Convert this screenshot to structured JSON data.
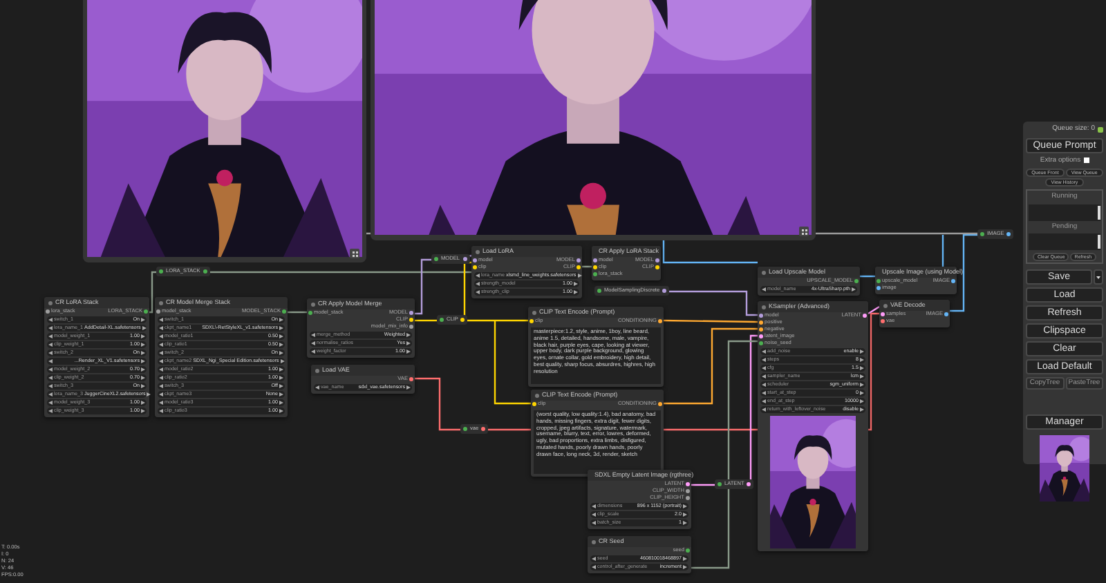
{
  "previews": [
    {
      "kind": "picture"
    },
    {
      "kind": "picture"
    }
  ],
  "nodes": [
    {
      "title": "CR LoRA Stack",
      "inputs": [
        {
          "name": "lora_stack",
          "color": "#9e9e9e"
        }
      ],
      "outputs": [
        {
          "name": "LORA_STACK",
          "color": "#4caf50"
        }
      ],
      "widgets": [
        {
          "label": "switch_1",
          "value": "On"
        },
        {
          "label": "lora_name_1",
          "value": "AddDetail-XL.safetensors"
        },
        {
          "label": "model_weight_1",
          "value": "1.00"
        },
        {
          "label": "clip_weight_1",
          "value": "1.00"
        },
        {
          "label": "switch_2",
          "value": "On"
        },
        {
          "value": "...Render_XL_V1.safetensors"
        },
        {
          "label": "model_weight_2",
          "value": "0.70"
        },
        {
          "label": "clip_weight_2",
          "value": "0.70"
        },
        {
          "label": "switch_3",
          "value": "On"
        },
        {
          "label": "lora_name_3",
          "value": "JuggerCineXL2.safetensors"
        },
        {
          "label": "model_weight_3",
          "value": "1.00"
        },
        {
          "label": "clip_weight_3",
          "value": "1.00"
        }
      ]
    },
    {
      "title": "CR Model Merge Stack",
      "inputs": [
        {
          "name": "model_stack",
          "color": "#9e9e9e"
        }
      ],
      "outputs": [
        {
          "name": "MODEL_STACK",
          "color": "#4caf50"
        }
      ],
      "widgets": [
        {
          "label": "switch_1",
          "value": "On"
        },
        {
          "label": "ckpt_name1",
          "value": "SDXL\\-RetStyleXL_v1.safetensors"
        },
        {
          "label": "model_ratio1",
          "value": "0.50"
        },
        {
          "label": "clip_ratio1",
          "value": "0.50"
        },
        {
          "label": "switch_2",
          "value": "On"
        },
        {
          "label": "ckpt_name2",
          "value": "SDXL_Ngi_Special Edition.safetensors"
        },
        {
          "label": "model_ratio2",
          "value": "1.00"
        },
        {
          "label": "clip_ratio2",
          "value": "1.00"
        },
        {
          "label": "switch_3",
          "value": "Off"
        },
        {
          "label": "ckpt_name3",
          "value": "None"
        },
        {
          "label": "model_ratio3",
          "value": "1.00"
        },
        {
          "label": "clip_ratio3",
          "value": "1.00"
        }
      ]
    },
    {
      "title": "CR Apply Model Merge",
      "inputs": [
        {
          "name": "model_stack",
          "color": "#4caf50"
        }
      ],
      "outputs": [
        {
          "name": "MODEL",
          "color": "#b39ddb"
        },
        {
          "name": "CLIP",
          "color": "#ffd500"
        },
        {
          "name": "model_mix_info",
          "color": "#9e9e9e"
        }
      ],
      "widgets": [
        {
          "label": "merge_method",
          "value": "Weighted"
        },
        {
          "label": "normalise_ratios",
          "value": "Yes"
        },
        {
          "label": "weight_factor",
          "value": "1.00"
        }
      ]
    },
    {
      "title": "Load VAE",
      "outputs": [
        {
          "name": "VAE",
          "color": "#ff6e6e"
        }
      ],
      "widgets": [
        {
          "label": "vae_name",
          "value": "sdxl_vae.safetensors"
        }
      ]
    },
    {
      "title": "Load LoRA",
      "inputs": [
        {
          "name": "model",
          "color": "#b39ddb"
        },
        {
          "name": "clip",
          "color": "#ffd500"
        }
      ],
      "outputs": [
        {
          "name": "MODEL",
          "color": "#b39ddb"
        },
        {
          "name": "CLIP",
          "color": "#ffd500"
        }
      ],
      "widgets": [
        {
          "label": "lora_name",
          "value": "xlsmd_line_weights.safetensors"
        },
        {
          "label": "strength_model",
          "value": "1.00"
        },
        {
          "label": "strength_clip",
          "value": "1.00"
        }
      ]
    },
    {
      "title": "CR Apply LoRA Stack",
      "inputs": [
        {
          "name": "model",
          "color": "#b39ddb"
        },
        {
          "name": "clip",
          "color": "#ffd500"
        },
        {
          "name": "lora_stack",
          "color": "#4caf50"
        }
      ],
      "outputs": [
        {
          "name": "MODEL",
          "color": "#b39ddb"
        },
        {
          "name": "CLIP",
          "color": "#ffd500"
        }
      ]
    },
    {
      "title": "CLIP Text Encode (Prompt)",
      "inputs": [
        {
          "name": "clip",
          "color": "#ffd500"
        }
      ],
      "outputs": [
        {
          "name": "CONDITIONING",
          "color": "#ffa931"
        }
      ],
      "prompt": "masterpiece:1.2, style, anime, 1boy, line beard, anime 1.5, detailed, handsome, male, vampire, black hair, purple eyes, cape, looking at viewer, upper body, dark purple background, glowing eyes, ornate collar, gold embroidery, high detail, best quality, sharp focus, absurdres, highres, high resolution"
    },
    {
      "title": "CLIP Text Encode (Prompt)",
      "inputs": [
        {
          "name": "clip",
          "color": "#ffd500"
        }
      ],
      "outputs": [
        {
          "name": "CONDITIONING",
          "color": "#ffa931"
        }
      ],
      "prompt": "(worst quality, low quality:1.4), bad anatomy, bad hands, missing fingers, extra digit, fewer digits, cropped, jpeg artifacts, signature, watermark, username, blurry, text, error, lowres, deformed, ugly, bad proportions, extra limbs, disfigured, mutated hands, poorly drawn hands, poorly drawn face, long neck, 3d, render, sketch"
    },
    {
      "title": "SDXL Empty Latent Image (rgthree)",
      "outputs": [
        {
          "name": "LATENT",
          "color": "#ff9cf9"
        },
        {
          "name": "CLIP_WIDTH",
          "color": "#9e9e9e"
        },
        {
          "name": "CLIP_HEIGHT",
          "color": "#9e9e9e"
        }
      ],
      "widgets": [
        {
          "label": "dimensions",
          "value": "896 x 1152 (portrait)"
        },
        {
          "label": "clip_scale",
          "value": "2.0"
        },
        {
          "label": "batch_size",
          "value": "1"
        }
      ]
    },
    {
      "title": "CR Seed",
      "outputs": [
        {
          "name": "seed",
          "color": "#4caf50"
        }
      ],
      "widgets": [
        {
          "label": "seed",
          "value": "460810018468897"
        },
        {
          "label": "control_after_generate",
          "value": "increment"
        }
      ]
    },
    {
      "title": "Load Upscale Model",
      "outputs": [
        {
          "name": "UPSCALE_MODEL",
          "color": "#4caf50"
        }
      ],
      "widgets": [
        {
          "label": "model_name",
          "value": "4x-UltraSharp.pth"
        }
      ]
    },
    {
      "title": "Upscale Image (using Model)",
      "inputs": [
        {
          "name": "upscale_model",
          "color": "#4caf50"
        },
        {
          "name": "image",
          "color": "#64b5f6"
        }
      ],
      "outputs": [
        {
          "name": "IMAGE",
          "color": "#64b5f6"
        }
      ]
    },
    {
      "title": "KSampler (Advanced)",
      "inputs": [
        {
          "name": "model",
          "color": "#b39ddb"
        },
        {
          "name": "positive",
          "color": "#ffa931"
        },
        {
          "name": "negative",
          "color": "#ffa931"
        },
        {
          "name": "latent_image",
          "color": "#ff9cf9"
        },
        {
          "name": "noise_seed",
          "color": "#4caf50"
        }
      ],
      "outputs": [
        {
          "name": "LATENT",
          "color": "#ff9cf9"
        }
      ],
      "widgets": [
        {
          "label": "add_noise",
          "value": "enable"
        },
        {
          "label": "steps",
          "value": "8"
        },
        {
          "label": "cfg",
          "value": "1.5"
        },
        {
          "label": "sampler_name",
          "value": "lcm"
        },
        {
          "label": "scheduler",
          "value": "sgm_uniform"
        },
        {
          "label": "start_at_step",
          "value": "0"
        },
        {
          "label": "end_at_step",
          "value": "10000"
        },
        {
          "label": "return_with_leftover_noise",
          "value": "disable"
        }
      ],
      "preview": {
        "kind": "picture"
      }
    },
    {
      "title": "VAE Decode",
      "inputs": [
        {
          "name": "samples",
          "color": "#ff9cf9"
        },
        {
          "name": "vae",
          "color": "#ff6e6e"
        }
      ],
      "outputs": [
        {
          "name": "IMAGE",
          "color": "#64b5f6"
        }
      ]
    }
  ],
  "reroutes": [
    {
      "label": "LORA_STACK",
      "color": "#4caf50"
    },
    {
      "label": "MODEL",
      "color": "#b39ddb"
    },
    {
      "label": "CLIP",
      "color": "#ffd500"
    },
    {
      "label": "ModelSamplingDiscrete",
      "color": "#b39ddb"
    },
    {
      "label": "vae",
      "color": "#ff6e6e"
    },
    {
      "label": "LATENT",
      "color": "#ff9cf9"
    },
    {
      "label": "IMAGE",
      "color": "#64b5f6"
    }
  ],
  "panel": {
    "queue_size": "Queue size: 0",
    "queue_button": "Queue Prompt",
    "extra_options": {
      "label": "Extra options",
      "checked": false
    },
    "small_buttons": [
      "Queue Front",
      "View Queue",
      "View History"
    ],
    "running": "Running",
    "pending": "Pending",
    "list_buttons": [
      "Clear Queue",
      "Refresh"
    ],
    "save": "Save",
    "menu": [
      "Load",
      "Refresh",
      "Clipspace",
      "Clear",
      "Load Default"
    ],
    "tree_buttons": [
      "CopyTree",
      "PasteTree"
    ],
    "manager": "Manager",
    "thumbnail": {
      "kind": "picture"
    }
  },
  "stats": [
    "T: 0.00s",
    "I: 0",
    "N: 24",
    "V: 46",
    "FPS:0.00"
  ]
}
